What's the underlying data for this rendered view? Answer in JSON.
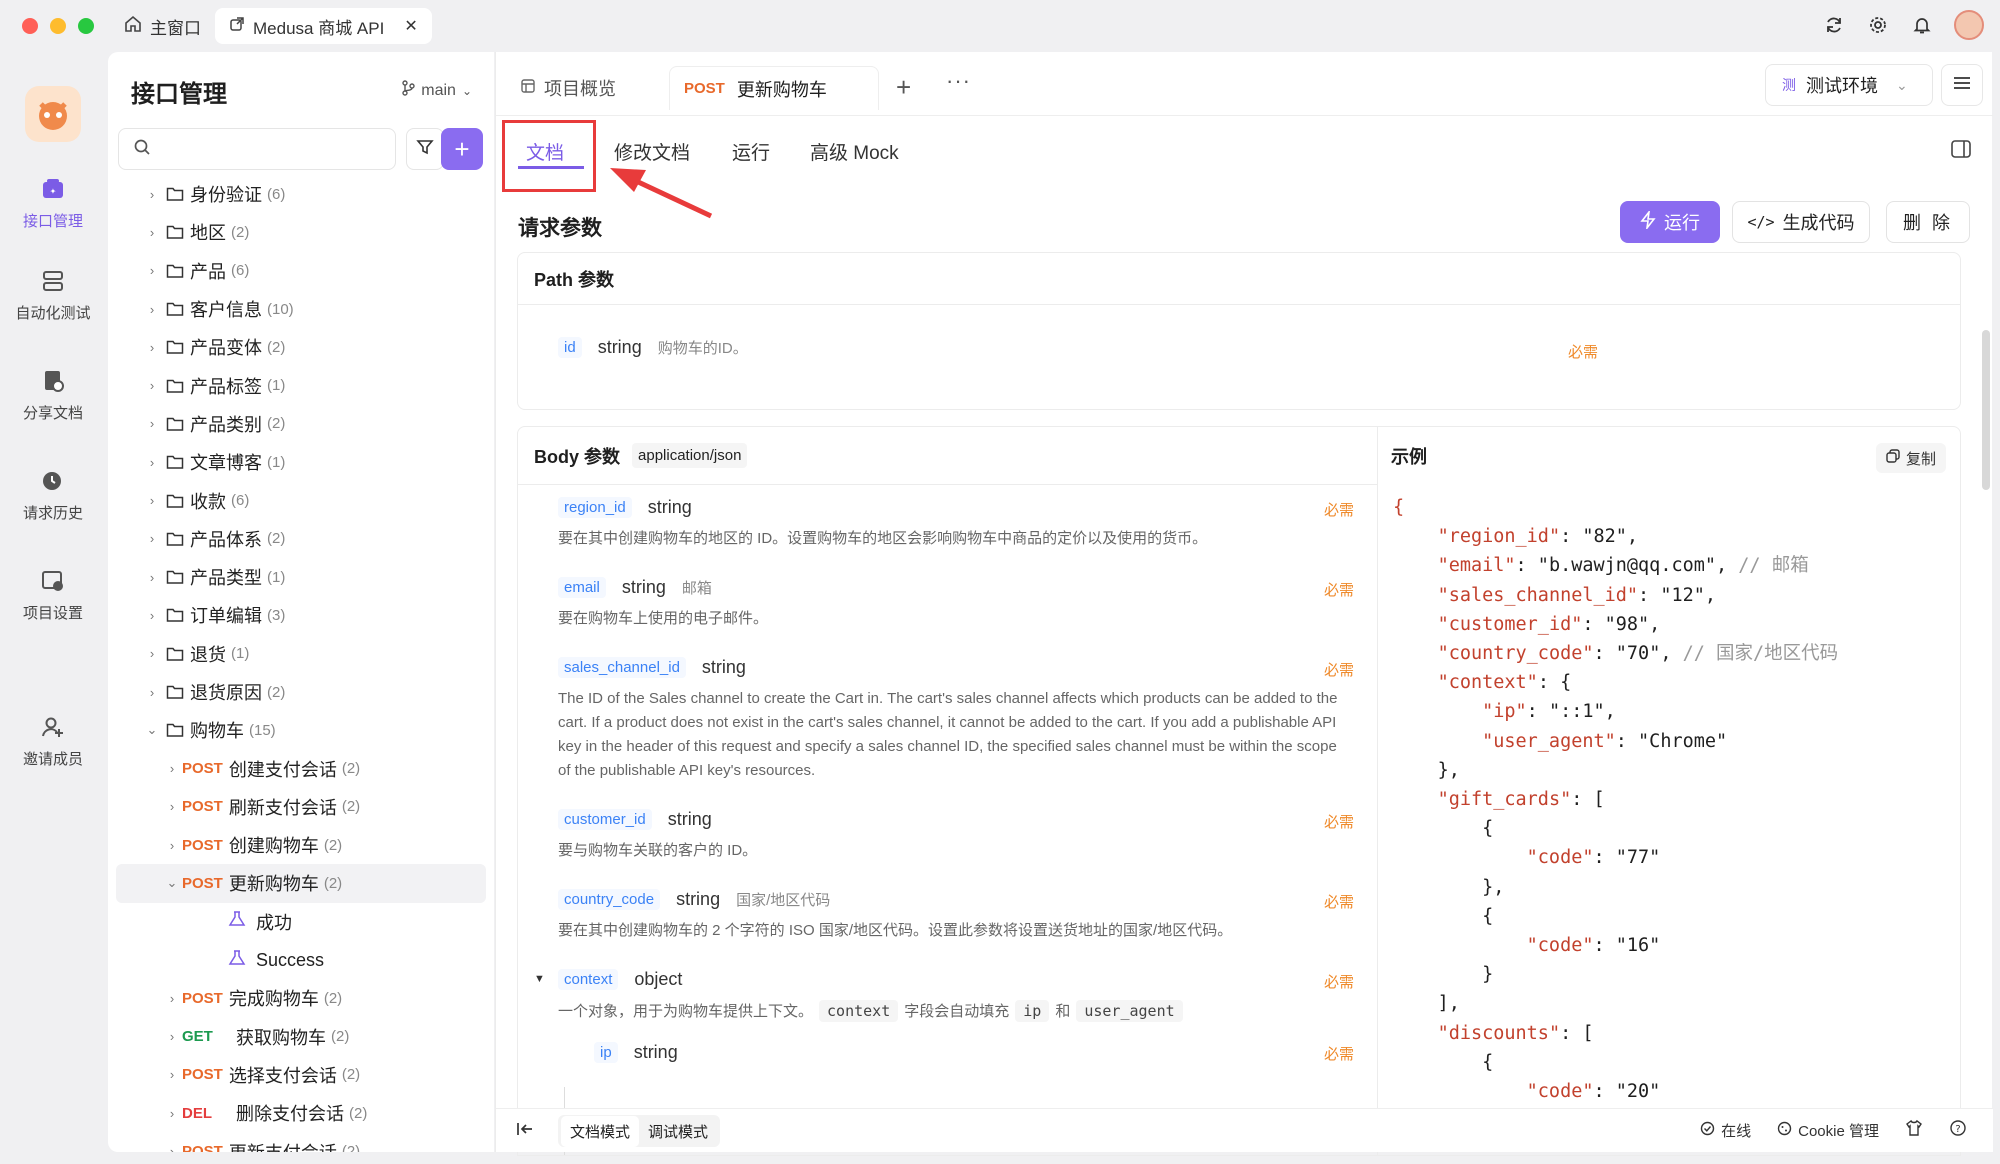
{
  "window": {
    "home_tab": "主窗口",
    "active_tab": "Medusa 商城 API"
  },
  "rail": [
    {
      "label": "接口管理",
      "icon": "api-icon"
    },
    {
      "label": "自动化测试",
      "icon": "automation-icon"
    },
    {
      "label": "分享文档",
      "icon": "share-doc-icon"
    },
    {
      "label": "请求历史",
      "icon": "history-icon"
    },
    {
      "label": "项目设置",
      "icon": "settings-icon"
    },
    {
      "label": "邀请成员",
      "icon": "invite-icon"
    }
  ],
  "sidebar": {
    "title": "接口管理",
    "branch": "main",
    "search_placeholder": "",
    "folders": [
      {
        "name": "身份验证",
        "count": "(6)"
      },
      {
        "name": "地区",
        "count": "(2)"
      },
      {
        "name": "产品",
        "count": "(6)"
      },
      {
        "name": "客户信息",
        "count": "(10)"
      },
      {
        "name": "产品变体",
        "count": "(2)"
      },
      {
        "name": "产品标签",
        "count": "(1)"
      },
      {
        "name": "产品类别",
        "count": "(2)"
      },
      {
        "name": "文章博客",
        "count": "(1)"
      },
      {
        "name": "收款",
        "count": "(6)"
      },
      {
        "name": "产品体系",
        "count": "(2)"
      },
      {
        "name": "产品类型",
        "count": "(1)"
      },
      {
        "name": "订单编辑",
        "count": "(3)"
      },
      {
        "name": "退货",
        "count": "(1)"
      },
      {
        "name": "退货原因",
        "count": "(2)"
      },
      {
        "name": "购物车",
        "count": "(15)"
      }
    ],
    "endpoints": [
      {
        "method": "POST",
        "name": "创建支付会话",
        "count": "(2)"
      },
      {
        "method": "POST",
        "name": "刷新支付会话",
        "count": "(2)"
      },
      {
        "method": "POST",
        "name": "创建购物车",
        "count": "(2)"
      },
      {
        "method": "POST",
        "name": "更新购物车",
        "count": "(2)"
      },
      {
        "method": "POST",
        "name": "完成购物车",
        "count": "(2)"
      },
      {
        "method": "GET",
        "name": "获取购物车",
        "count": "(2)"
      },
      {
        "method": "POST",
        "name": "选择支付会话",
        "count": "(2)"
      },
      {
        "method": "DEL",
        "name": "删除支付会话",
        "count": "(2)"
      },
      {
        "method": "POST",
        "name": "更新支付会话",
        "count": "(2)"
      }
    ],
    "examples": [
      "成功",
      "Success"
    ]
  },
  "tabs": {
    "overview": "项目概览",
    "current_method": "POST",
    "current_name": "更新购物车",
    "env": "测试环境",
    "env_badge": "测"
  },
  "subtabs": [
    "文档",
    "修改文档",
    "运行",
    "高级 Mock"
  ],
  "doc": {
    "section_title": "请求参数",
    "run_label": "运行",
    "gen_label": "生成代码",
    "del_label": "删 除",
    "path_title": "Path 参数",
    "path_param": {
      "name": "id",
      "type": "string",
      "desc": "购物车的ID。",
      "required": "必需"
    },
    "body_title": "Body 参数",
    "content_type": "application/json",
    "example_title": "示例",
    "copy_label": "复制",
    "params": [
      {
        "name": "region_id",
        "type": "string",
        "extra": "",
        "required": "必需",
        "desc": "要在其中创建购物车的地区的 ID。设置购物车的地区会影响购物车中商品的定价以及使用的货币。"
      },
      {
        "name": "email",
        "type": "string",
        "extra": "邮箱",
        "required": "必需",
        "desc": "要在购物车上使用的电子邮件。"
      },
      {
        "name": "sales_channel_id",
        "type": "string",
        "extra": "",
        "required": "必需",
        "desc": "The ID of the Sales channel to create the Cart in. The cart's sales channel affects which products can be added to the cart. If a product does not exist in the cart's sales channel, it cannot be added to the cart. If you add a publishable API key in the header of this request and specify a sales channel ID, the specified sales channel must be within the scope of the publishable API key's resources."
      },
      {
        "name": "customer_id",
        "type": "string",
        "extra": "",
        "required": "必需",
        "desc": "要与购物车关联的客户的 ID。"
      },
      {
        "name": "country_code",
        "type": "string",
        "extra": "国家/地区代码",
        "required": "必需",
        "desc": "要在其中创建购物车的 2 个字符的 ISO 国家/地区代码。设置此参数将设置送货地址的国家/地区代码。"
      },
      {
        "name": "context",
        "type": "object",
        "extra": "",
        "required": "必需",
        "desc_pre": "一个对象，用于为购物车提供上下文。",
        "chip1": "context",
        "desc_mid": "字段会自动填充",
        "chip2": "ip",
        "desc_and": "和",
        "chip3": "user_agent"
      },
      {
        "name": "ip",
        "type": "string",
        "extra": "",
        "required": "必需"
      }
    ],
    "example_lines": [
      [
        "",
        "{",
        ""
      ],
      [
        "    ",
        "\"region_id\"",
        ": \"82\","
      ],
      [
        "    ",
        "\"email\"",
        ": \"b.wawjn@qq.com\", ",
        "// 邮箱"
      ],
      [
        "    ",
        "\"sales_channel_id\"",
        ": \"12\","
      ],
      [
        "    ",
        "\"customer_id\"",
        ": \"98\","
      ],
      [
        "    ",
        "\"country_code\"",
        ": \"70\", ",
        "// 国家/地区代码"
      ],
      [
        "    ",
        "\"context\"",
        ": {"
      ],
      [
        "        ",
        "\"ip\"",
        ": \"::1\","
      ],
      [
        "        ",
        "\"user_agent\"",
        ": \"Chrome\""
      ],
      [
        "    ",
        "",
        "},"
      ],
      [
        "    ",
        "\"gift_cards\"",
        ": ["
      ],
      [
        "        ",
        "",
        "{"
      ],
      [
        "            ",
        "\"code\"",
        ": \"77\""
      ],
      [
        "        ",
        "",
        "},"
      ],
      [
        "        ",
        "",
        "{"
      ],
      [
        "            ",
        "\"code\"",
        ": \"16\""
      ],
      [
        "        ",
        "",
        "}"
      ],
      [
        "    ",
        "",
        "],"
      ],
      [
        "    ",
        "\"discounts\"",
        ": ["
      ],
      [
        "        ",
        "",
        "{"
      ],
      [
        "            ",
        "\"code\"",
        ": \"20\""
      ]
    ]
  },
  "bottom": {
    "doc_mode": "文档模式",
    "debug_mode": "调试模式",
    "online": "在线",
    "cookie": "Cookie 管理"
  }
}
